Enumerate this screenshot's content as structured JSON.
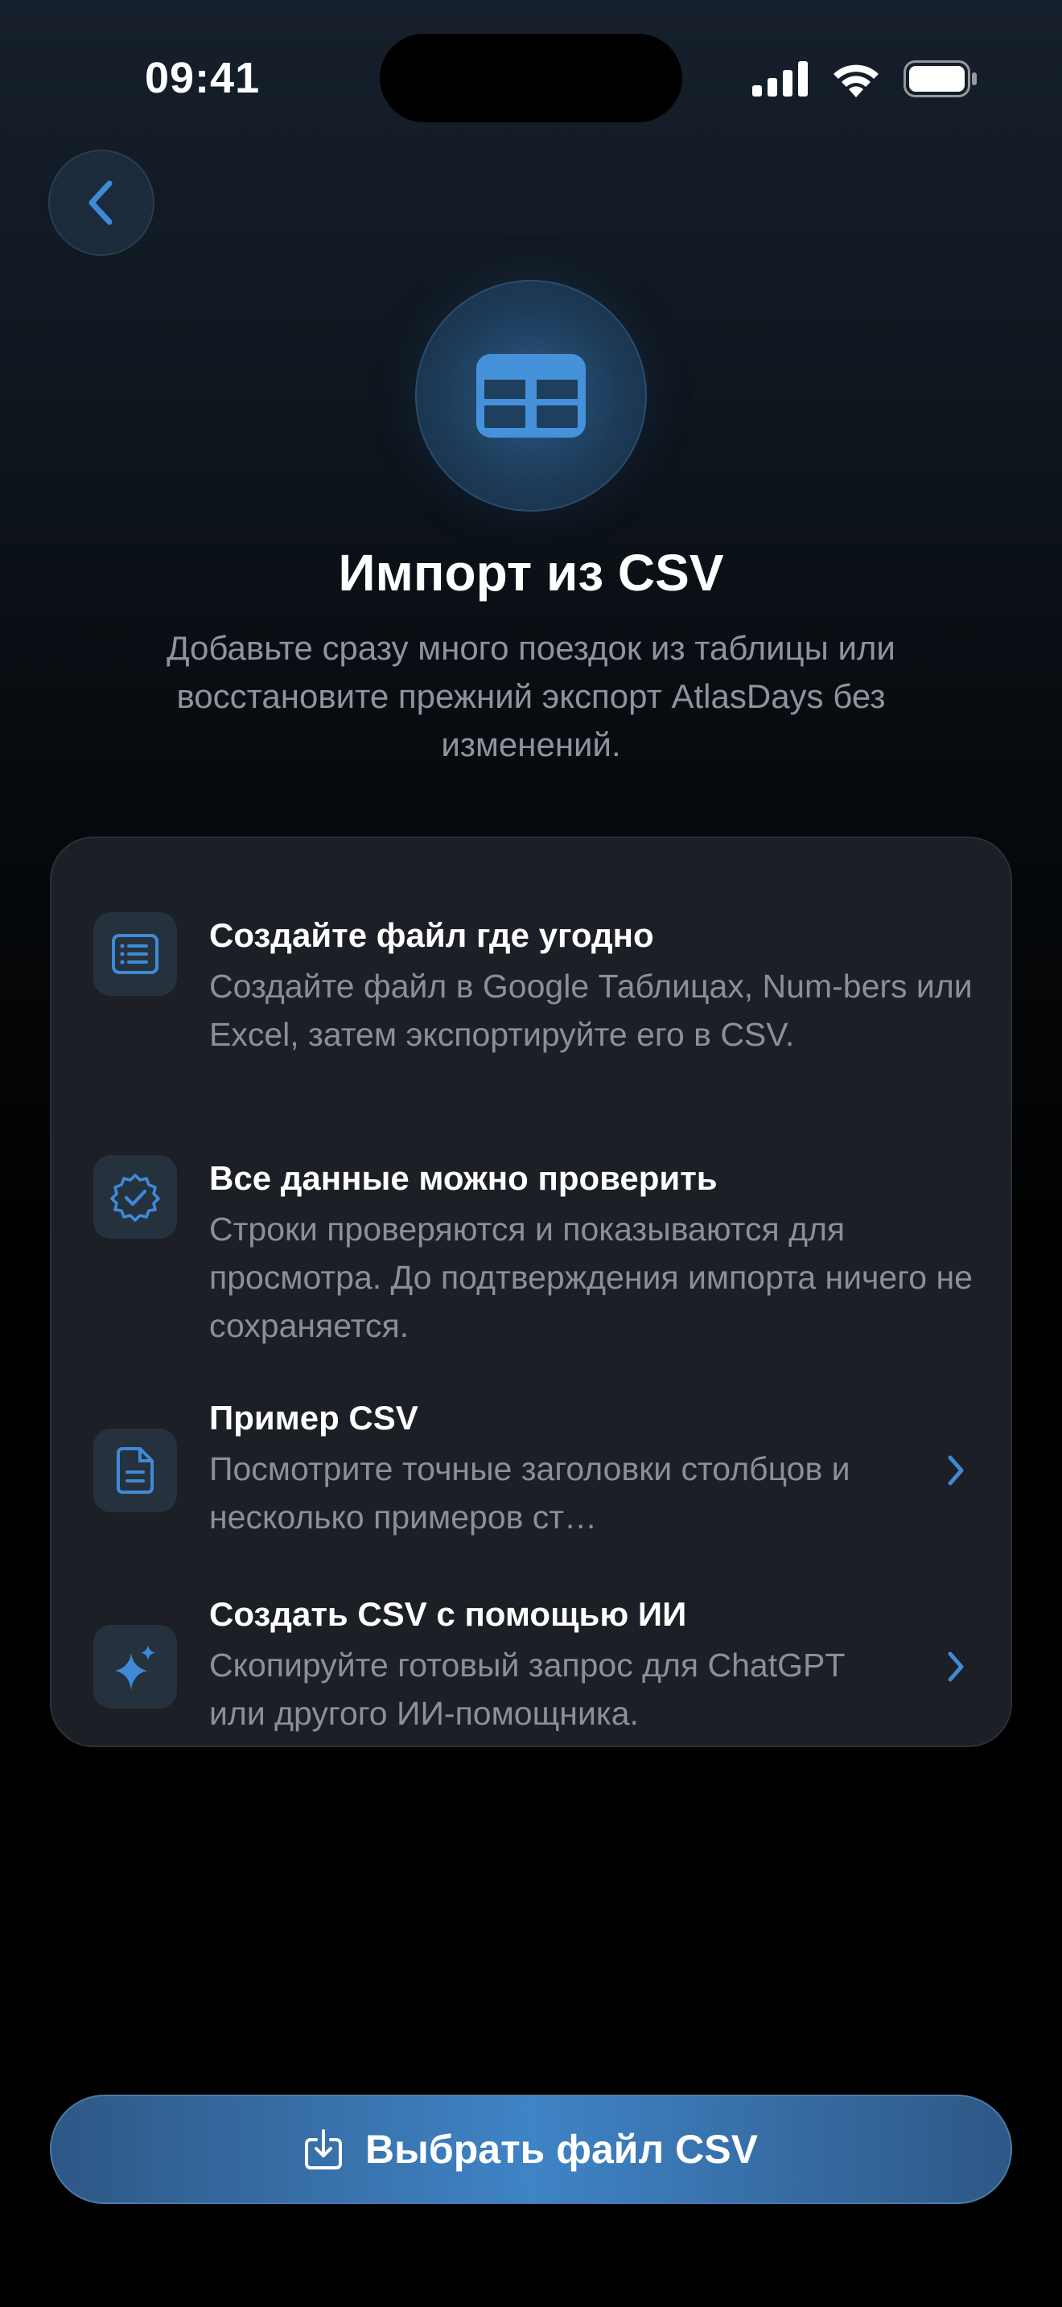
{
  "status_bar": {
    "time": "09:41"
  },
  "header": {
    "back_icon": "chevron-left-icon",
    "hero_icon": "table-icon",
    "title": "Импорт из CSV",
    "subtitle": "Добавьте сразу много поездок из таблицы или восстановите прежний экспорт AtlasDays без изменений."
  },
  "features": [
    {
      "icon": "list-document-icon",
      "title": "Создайте файл где угодно",
      "description": "Создайте файл в Google Таблицах, Num-bers или Excel, затем экспортируйте его в CSV.",
      "has_chevron": false
    },
    {
      "icon": "checkmark-seal-icon",
      "title": "Все данные можно проверить",
      "description": "Строки проверяются и показываются для просмотра. До подтверждения импорта ничего не сохраняется.",
      "has_chevron": false
    },
    {
      "icon": "document-icon",
      "title": "Пример CSV",
      "description": "Посмотрите точные заголовки столбцов и несколько примеров ст…",
      "has_chevron": true
    },
    {
      "icon": "sparkles-icon",
      "title": "Создать CSV с помощью ИИ",
      "description": "Скопируйте готовый запрос для ChatGPT или другого ИИ-помощника.",
      "has_chevron": true
    }
  ],
  "primary_button": {
    "icon": "tray-download-icon",
    "label": "Выбрать файл CSV"
  },
  "colors": {
    "accent": "#3f8ad6",
    "card_background": "#1c1f25",
    "secondary_text": "#8a9099"
  }
}
